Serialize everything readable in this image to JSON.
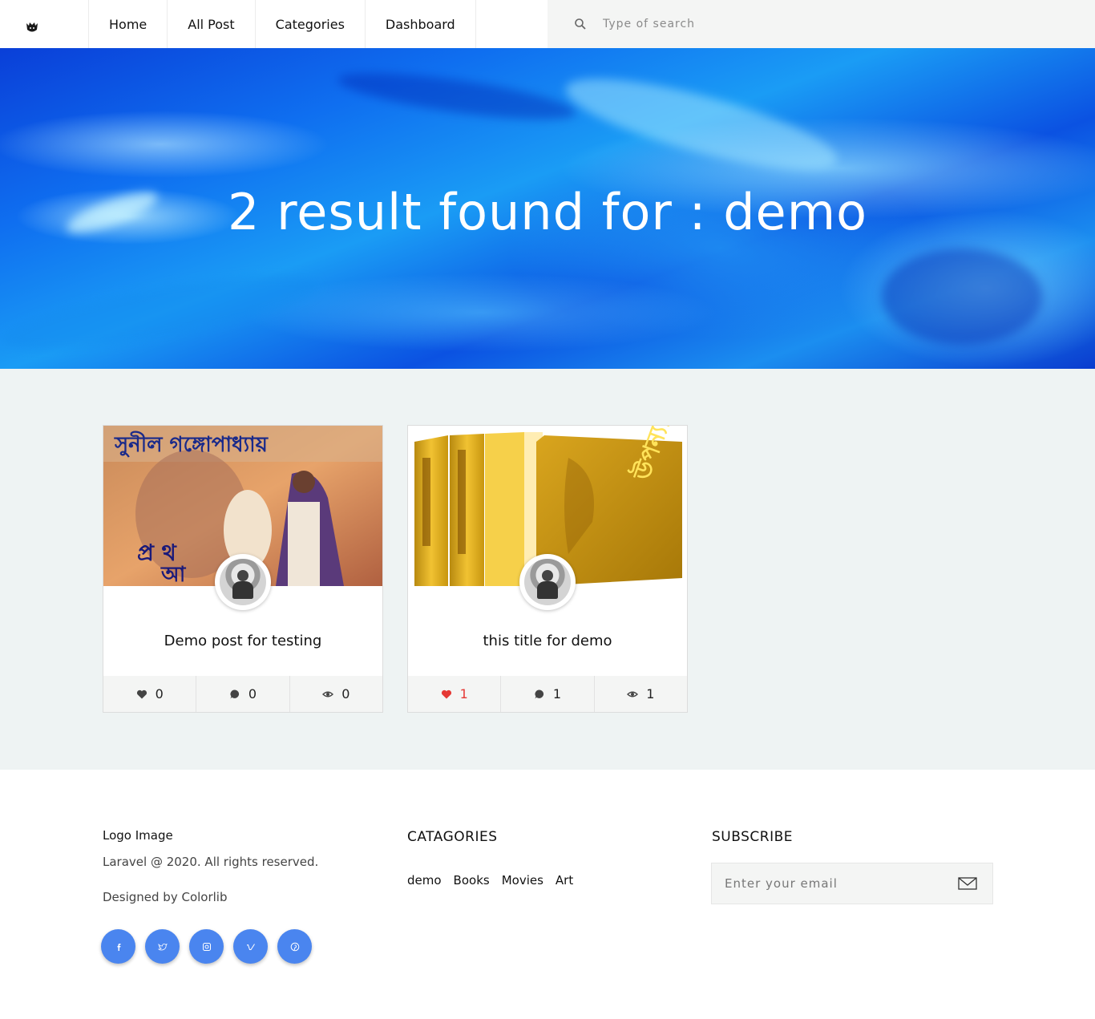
{
  "nav": {
    "logo_icon": "cat-logo-icon",
    "items": [
      {
        "label": "Home"
      },
      {
        "label": "All Post"
      },
      {
        "label": "Categories"
      },
      {
        "label": "Dashboard"
      }
    ],
    "search_placeholder": "Type of search",
    "search_icon": "search-icon"
  },
  "hero": {
    "heading": "2 result found for : demo",
    "accent": "#0f6ff0"
  },
  "results": {
    "cards": [
      {
        "title": "Demo post for testing",
        "likes": "0",
        "comments": "0",
        "views": "0",
        "liked": false
      },
      {
        "title": "this title for demo",
        "likes": "1",
        "comments": "1",
        "views": "1",
        "liked": true
      }
    ]
  },
  "footer": {
    "logo_text": "Logo Image",
    "copyright": "Laravel @ 2020. All rights reserved.",
    "designed_by": "Designed by Colorlib",
    "socials": [
      "facebook-icon",
      "twitter-icon",
      "instagram-icon",
      "vimeo-icon",
      "pinterest-icon"
    ],
    "social_color": "#4a85ef",
    "categories_title": "CATAGORIES",
    "categories": [
      "demo",
      "Books",
      "Movies",
      "Art"
    ],
    "subscribe_title": "SUBSCRIBE",
    "email_placeholder": "Enter your email",
    "like_color": "#e53935"
  }
}
